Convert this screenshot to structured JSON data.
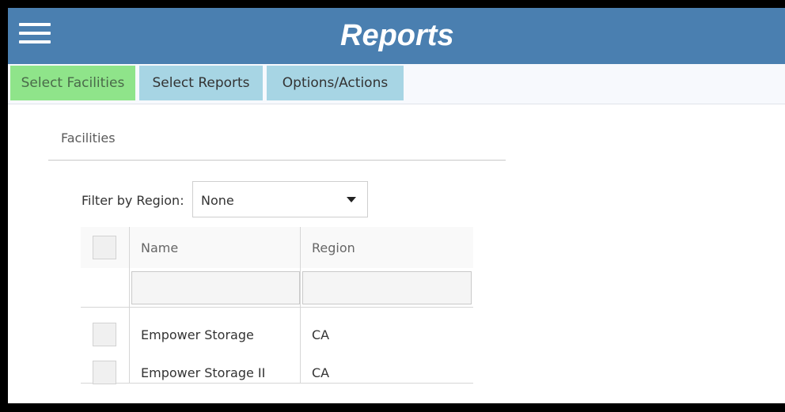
{
  "header": {
    "menu_icon": "hamburger-menu-icon",
    "title": "Reports"
  },
  "tabs": [
    {
      "label": "Select Facilities",
      "active": true
    },
    {
      "label": "Select Reports",
      "active": false
    },
    {
      "label": "Options/Actions",
      "active": false
    }
  ],
  "facilities": {
    "section_label": "Facilities",
    "filter_label": "Filter by Region:",
    "filter_value": "None",
    "columns": [
      "Name",
      "Region"
    ],
    "rows": [
      {
        "name": "Empower Storage",
        "region": "CA"
      },
      {
        "name": "Empower Storage II",
        "region": "CA"
      }
    ]
  },
  "colors": {
    "header_bg": "#4a7fb0",
    "active_tab": "#8fe48a",
    "inactive_tab": "#a7d5e4"
  }
}
